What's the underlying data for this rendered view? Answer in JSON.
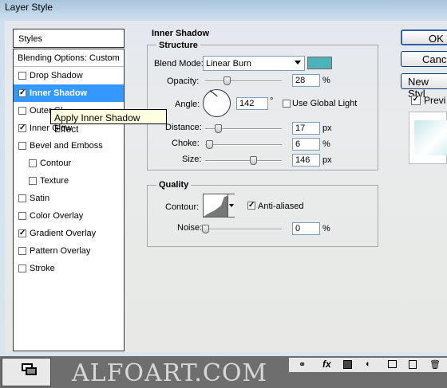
{
  "window": {
    "title": "Layer Style"
  },
  "left_panel": {
    "header": "Styles",
    "blending_options": "Blending Options: Custom",
    "items": [
      {
        "label": "Drop Shadow",
        "checked": false,
        "selected": false,
        "sub": false
      },
      {
        "label": "Inner Shadow",
        "checked": true,
        "selected": true,
        "sub": false
      },
      {
        "label": "Outer Gl",
        "checked": false,
        "selected": false,
        "sub": false
      },
      {
        "label": "Inner Glow",
        "checked": true,
        "selected": false,
        "sub": false
      },
      {
        "label": "Bevel and Emboss",
        "checked": false,
        "selected": false,
        "sub": false
      },
      {
        "label": "Contour",
        "checked": false,
        "selected": false,
        "sub": true
      },
      {
        "label": "Texture",
        "checked": false,
        "selected": false,
        "sub": true
      },
      {
        "label": "Satin",
        "checked": false,
        "selected": false,
        "sub": false
      },
      {
        "label": "Color Overlay",
        "checked": false,
        "selected": false,
        "sub": false
      },
      {
        "label": "Gradient Overlay",
        "checked": true,
        "selected": false,
        "sub": false
      },
      {
        "label": "Pattern Overlay",
        "checked": false,
        "selected": false,
        "sub": false
      },
      {
        "label": "Stroke",
        "checked": false,
        "selected": false,
        "sub": false
      }
    ]
  },
  "tooltip": "Apply Inner Shadow Effect",
  "inner_shadow": {
    "title": "Inner Shadow",
    "structure": {
      "title": "Structure",
      "blend_mode_label": "Blend Mode:",
      "blend_mode_value": "Linear Burn",
      "color": "#4db3b8",
      "opacity_label": "Opacity:",
      "opacity_value": "28",
      "opacity_unit": "%",
      "angle_label": "Angle:",
      "angle_value": "142",
      "angle_unit": "°",
      "global_light_label": "Use Global Light",
      "global_light_checked": false,
      "distance_label": "Distance:",
      "distance_value": "17",
      "distance_unit": "px",
      "choke_label": "Choke:",
      "choke_value": "6",
      "choke_unit": "%",
      "size_label": "Size:",
      "size_value": "146",
      "size_unit": "px"
    },
    "quality": {
      "title": "Quality",
      "contour_label": "Contour:",
      "anti_aliased_label": "Anti-aliased",
      "anti_aliased_checked": true,
      "noise_label": "Noise:",
      "noise_value": "0",
      "noise_unit": "%"
    }
  },
  "buttons": {
    "ok": "OK",
    "cancel": "Cance",
    "new_style": "New Styl",
    "preview": "Previ",
    "preview_checked": true
  },
  "taskbar": {
    "watermark": "ALFOART.COM"
  }
}
